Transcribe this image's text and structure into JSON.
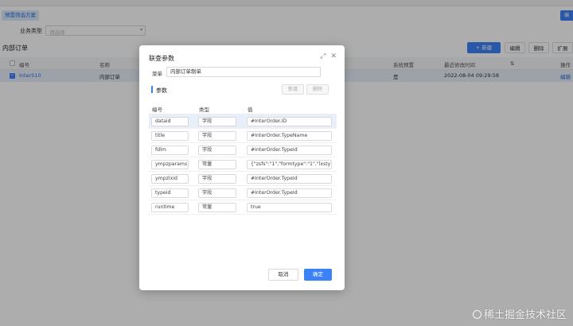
{
  "page": {
    "preset_tab": "预置筛选方案",
    "top_right_btn": "编",
    "filter_label": "业务类型",
    "filter_placeholder": "请选择",
    "section_title": "内部订单",
    "toolbar": {
      "new_label": "+ 新建",
      "edit_label": "编辑",
      "delete_label": "删除",
      "extend_label": "扩展"
    },
    "grid": {
      "headers": {
        "code": "编号",
        "name": "名称",
        "system_preset": "系统预置",
        "modified": "最近修改时间",
        "op": "操作"
      },
      "row": {
        "code": "InterS10",
        "name": "内部订单",
        "system_preset": "是",
        "modified": "2022-08-04 09:29:58",
        "op": "编辑"
      }
    }
  },
  "dialog": {
    "title": "联查参数",
    "menu_label": "菜单",
    "menu_value": "内部订单制单",
    "params_title": "参数",
    "new_btn": "新增",
    "delete_btn": "删除",
    "columns": {
      "code": "编号",
      "type": "类型",
      "value": "值"
    },
    "rows": [
      {
        "code": "dataid",
        "type": "字段",
        "value": "#InterOrder.ID"
      },
      {
        "code": "title",
        "type": "字段",
        "value": "#InterOrder.TypeName"
      },
      {
        "code": "fdlm",
        "type": "字段",
        "value": "#InterOrder.TypeId"
      },
      {
        "code": "ympzparams",
        "type": "常量",
        "value": "{\"zsfs\":\"1\",\"formtype\":\"1\",\"lxstyleid\""
      },
      {
        "code": "ympzlxid",
        "type": "字段",
        "value": "#InterOrder.TypeId"
      },
      {
        "code": "typeid",
        "type": "字段",
        "value": "#InterOrder.TypeId"
      },
      {
        "code": "runtime",
        "type": "常量",
        "value": "true"
      }
    ],
    "cancel_btn": "取消",
    "ok_btn": "确定"
  },
  "watermark": "稀土掘金技术社区",
  "colors": {
    "primary": "#3b82f6",
    "selected_row": "#e7effb"
  }
}
